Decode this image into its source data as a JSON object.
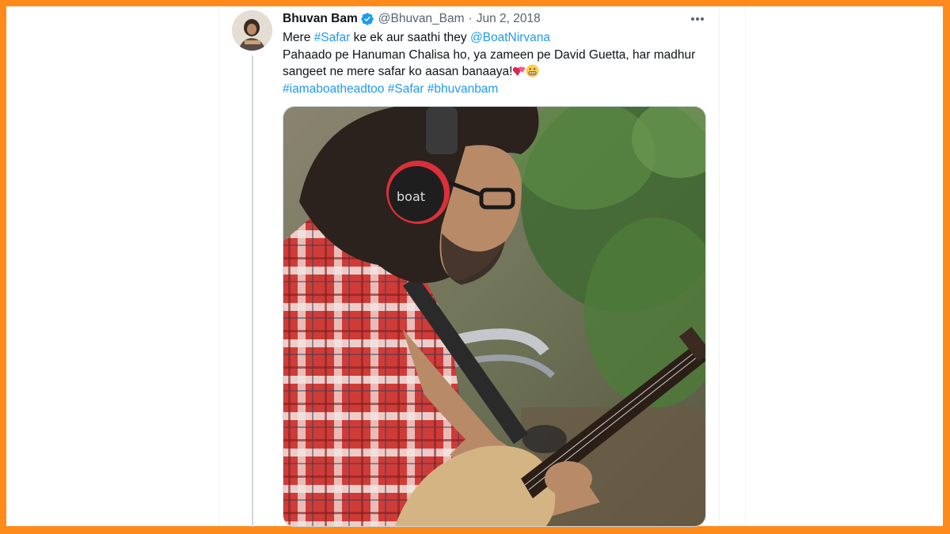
{
  "tweet": {
    "author_name": "Bhuvan Bam",
    "handle": "@Bhuvan_Bam",
    "separator": "·",
    "date": "Jun 2, 2018",
    "line1": {
      "t1": "Mere ",
      "tag1": "#Safar",
      "t2": " ke ek aur saathi they ",
      "mention": "@BoatNirvana"
    },
    "line2": "Pahaado pe Hanuman Chalisa ho, ya zameen pe David Guetta, har madhur",
    "line3": "sangeet ne mere safar ko aasan banaaya!",
    "hashtags": [
      "#iamaboatheadtoo",
      "#Safar",
      "#bhuvanbam"
    ],
    "headphone_brand": "boat",
    "emojis": [
      "two-hearts-emoji",
      "grimacing-face-emoji"
    ]
  },
  "icons": {
    "verified": "verified-badge-icon",
    "more": "more-horizontal-icon"
  },
  "colors": {
    "frame": "#ff8a1c",
    "link": "#1d9bf0",
    "text": "#0f1419",
    "muted": "#536471",
    "verified": "#1d9bf0"
  }
}
